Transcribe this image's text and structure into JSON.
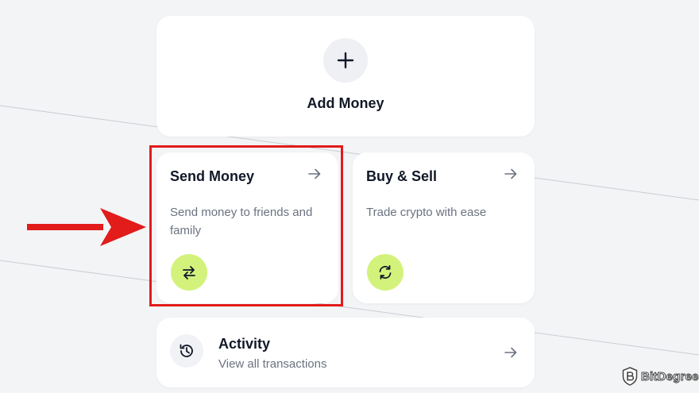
{
  "add_money": {
    "label": "Add Money",
    "icon": "plus-icon"
  },
  "send_money": {
    "title": "Send Money",
    "description": "Send money to friends and family",
    "icon": "swap-arrows-icon"
  },
  "buy_sell": {
    "title": "Buy & Sell",
    "description": "Trade crypto with ease",
    "icon": "refresh-icon"
  },
  "activity": {
    "title": "Activity",
    "subtitle": "View all transactions",
    "icon": "history-icon"
  },
  "watermark": {
    "text": "BitDegree"
  },
  "colors": {
    "background": "#f3f4f6",
    "card": "#ffffff",
    "accent_green": "#d3f27c",
    "highlight_red": "#e21b1b",
    "muted_text": "#6b7280"
  }
}
